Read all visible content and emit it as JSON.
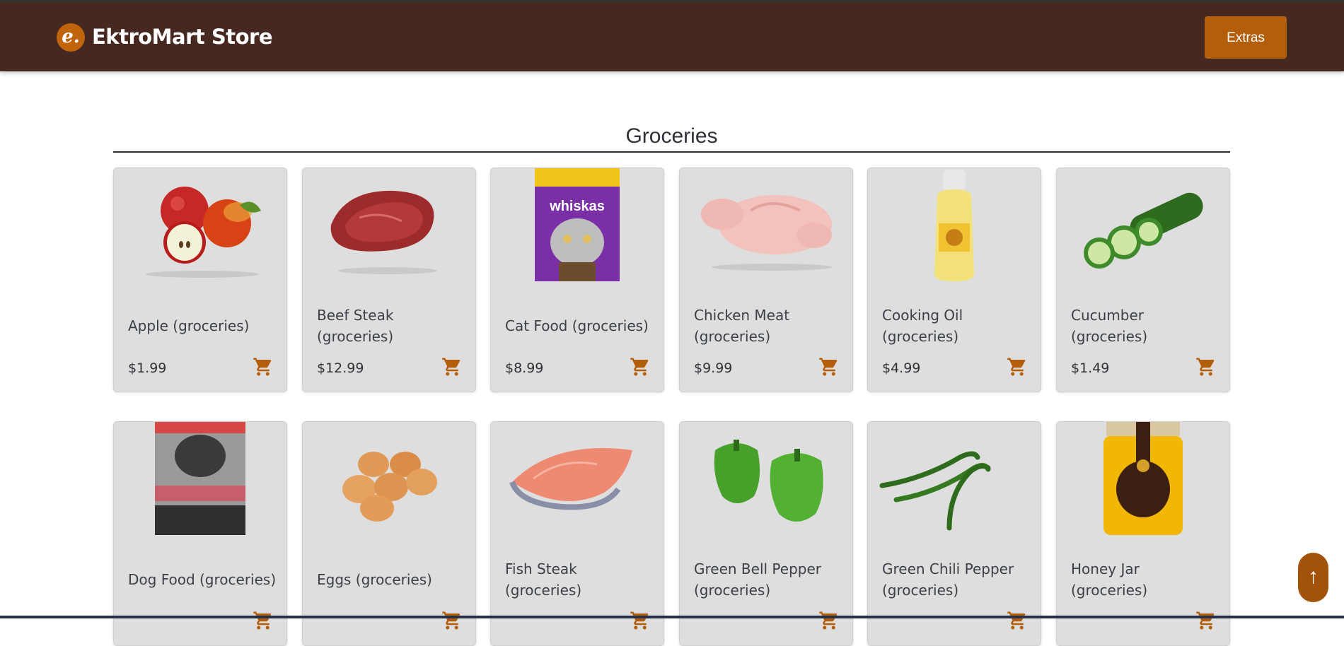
{
  "header": {
    "logo_letter": "e.",
    "brand": "EktroMart Store",
    "extras_label": "Extras"
  },
  "section": {
    "title": "Groceries"
  },
  "products": [
    {
      "name": "Apple (groceries)",
      "price": "$1.99",
      "icon": "apple"
    },
    {
      "name": "Beef Steak (groceries)",
      "price": "$12.99",
      "icon": "steak"
    },
    {
      "name": "Cat Food (groceries)",
      "price": "$8.99",
      "icon": "cat-food-pouch"
    },
    {
      "name": "Chicken Meat (groceries)",
      "price": "$9.99",
      "icon": "chicken"
    },
    {
      "name": "Cooking Oil (groceries)",
      "price": "$4.99",
      "icon": "oil-bottle"
    },
    {
      "name": "Cucumber (groceries)",
      "price": "$1.49",
      "icon": "cucumber"
    },
    {
      "name": "Dog Food (groceries)",
      "price": "",
      "icon": "dog-food-bag"
    },
    {
      "name": "Eggs (groceries)",
      "price": "",
      "icon": "eggs"
    },
    {
      "name": "Fish Steak (groceries)",
      "price": "",
      "icon": "fish-steak"
    },
    {
      "name": "Green Bell Pepper (groceries)",
      "price": "",
      "icon": "bell-pepper"
    },
    {
      "name": "Green Chili Pepper (groceries)",
      "price": "",
      "icon": "chili-pepper"
    },
    {
      "name": "Honey Jar (groceries)",
      "price": "",
      "icon": "honey-jar"
    }
  ],
  "scroll_top_label": "↑",
  "colors": {
    "header_bg": "#452820",
    "accent": "#b35e0b",
    "card_bg": "#dedede"
  }
}
